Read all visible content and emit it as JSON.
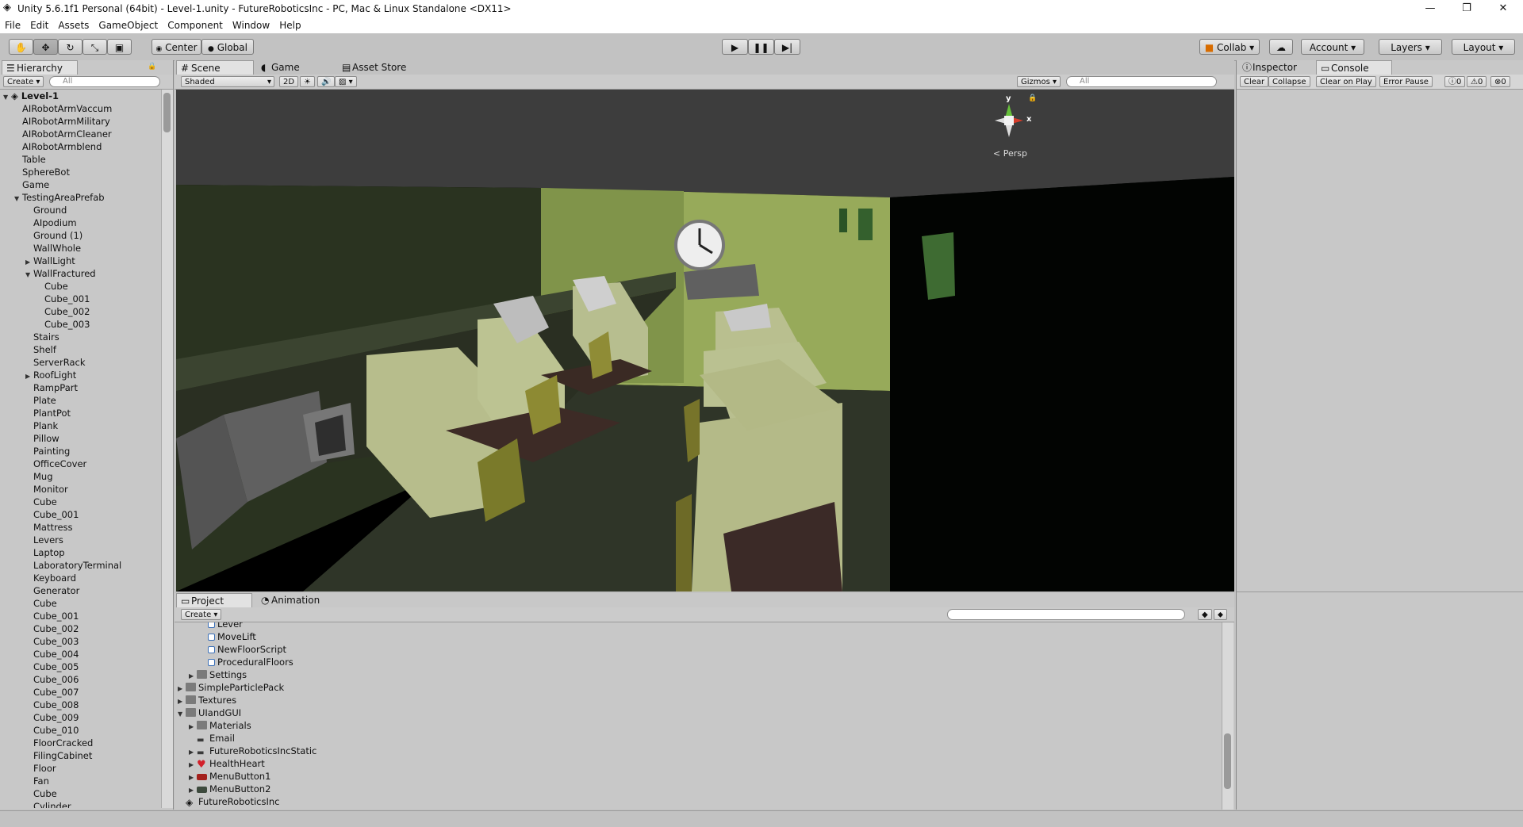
{
  "window": {
    "title": "Unity 5.6.1f1 Personal (64bit) - Level-1.unity - FutureRoboticsInc - PC, Mac & Linux Standalone <DX11>",
    "minimize": "—",
    "maximize": "❐",
    "close": "✕"
  },
  "menu": [
    "File",
    "Edit",
    "Assets",
    "GameObject",
    "Component",
    "Window",
    "Help"
  ],
  "toolbar": {
    "pivot": "Center",
    "space": "Global",
    "collab": "Collab",
    "account": "Account",
    "layers": "Layers",
    "layout": "Layout"
  },
  "hierarchy": {
    "tab": "Hierarchy",
    "create": "Create",
    "search_placeholder": "All",
    "scene": "Level-1",
    "items": [
      {
        "label": "AIRobotArmVaccum",
        "indent": 1
      },
      {
        "label": "AIRobotArmMilitary",
        "indent": 1
      },
      {
        "label": "AIRobotArmCleaner",
        "indent": 1
      },
      {
        "label": "AIRobotArmblend",
        "indent": 1
      },
      {
        "label": "Table",
        "indent": 1
      },
      {
        "label": "SphereBot",
        "indent": 1
      },
      {
        "label": "Game",
        "indent": 1
      },
      {
        "label": "TestingAreaPrefab",
        "indent": 1,
        "expanded": true
      },
      {
        "label": "Ground",
        "indent": 2
      },
      {
        "label": "AIpodium",
        "indent": 2
      },
      {
        "label": "Ground (1)",
        "indent": 2
      },
      {
        "label": "WallWhole",
        "indent": 2
      },
      {
        "label": "WallLight",
        "indent": 2,
        "collapsed": true
      },
      {
        "label": "WallFractured",
        "indent": 2,
        "expanded": true
      },
      {
        "label": "Cube",
        "indent": 3
      },
      {
        "label": "Cube_001",
        "indent": 3
      },
      {
        "label": "Cube_002",
        "indent": 3
      },
      {
        "label": "Cube_003",
        "indent": 3
      },
      {
        "label": "Stairs",
        "indent": 2
      },
      {
        "label": "Shelf",
        "indent": 2
      },
      {
        "label": "ServerRack",
        "indent": 2
      },
      {
        "label": "RoofLight",
        "indent": 2,
        "collapsed": true
      },
      {
        "label": "RampPart",
        "indent": 2
      },
      {
        "label": "Plate",
        "indent": 2
      },
      {
        "label": "PlantPot",
        "indent": 2
      },
      {
        "label": "Plank",
        "indent": 2
      },
      {
        "label": "Pillow",
        "indent": 2
      },
      {
        "label": "Painting",
        "indent": 2
      },
      {
        "label": "OfficeCover",
        "indent": 2
      },
      {
        "label": "Mug",
        "indent": 2
      },
      {
        "label": "Monitor",
        "indent": 2
      },
      {
        "label": "Cube",
        "indent": 2
      },
      {
        "label": "Cube_001",
        "indent": 2
      },
      {
        "label": "Mattress",
        "indent": 2
      },
      {
        "label": "Levers",
        "indent": 2
      },
      {
        "label": "Laptop",
        "indent": 2
      },
      {
        "label": "LaboratoryTerminal",
        "indent": 2
      },
      {
        "label": "Keyboard",
        "indent": 2
      },
      {
        "label": "Generator",
        "indent": 2
      },
      {
        "label": "Cube",
        "indent": 2
      },
      {
        "label": "Cube_001",
        "indent": 2
      },
      {
        "label": "Cube_002",
        "indent": 2
      },
      {
        "label": "Cube_003",
        "indent": 2
      },
      {
        "label": "Cube_004",
        "indent": 2
      },
      {
        "label": "Cube_005",
        "indent": 2
      },
      {
        "label": "Cube_006",
        "indent": 2
      },
      {
        "label": "Cube_007",
        "indent": 2
      },
      {
        "label": "Cube_008",
        "indent": 2
      },
      {
        "label": "Cube_009",
        "indent": 2
      },
      {
        "label": "Cube_010",
        "indent": 2
      },
      {
        "label": "FloorCracked",
        "indent": 2
      },
      {
        "label": "FilingCabinet",
        "indent": 2
      },
      {
        "label": "Floor",
        "indent": 2
      },
      {
        "label": "Fan",
        "indent": 2
      },
      {
        "label": "Cube",
        "indent": 2
      },
      {
        "label": "Cylinder",
        "indent": 2
      }
    ]
  },
  "scene_tabs": {
    "scene": "Scene",
    "game": "Game",
    "asset_store": "Asset Store"
  },
  "scene_bar": {
    "shading": "Shaded",
    "mode2d": "2D",
    "gizmos": "Gizmos",
    "search_placeholder": "All"
  },
  "scene_view": {
    "projection": "Persp",
    "gizmo_y": "y",
    "gizmo_x": "x"
  },
  "inspector": {
    "tab_inspector": "Inspector",
    "tab_console": "Console",
    "clear": "Clear",
    "collapse": "Collapse",
    "clear_on_play": "Clear on Play",
    "error_pause": "Error Pause",
    "count_info": "0",
    "count_warn": "0",
    "count_error": "0"
  },
  "project": {
    "tab_project": "Project",
    "tab_animation": "Animation",
    "create": "Create",
    "items": [
      {
        "label": "Lever",
        "indent": 3,
        "icon": "script"
      },
      {
        "label": "MoveLift",
        "indent": 3,
        "icon": "script"
      },
      {
        "label": "NewFloorScript",
        "indent": 3,
        "icon": "script"
      },
      {
        "label": "ProceduralFloors",
        "indent": 3,
        "icon": "script"
      },
      {
        "label": "Settings",
        "indent": 2,
        "icon": "folder",
        "arrow": "right"
      },
      {
        "label": "SimpleParticlePack",
        "indent": 1,
        "icon": "folder",
        "arrow": "right"
      },
      {
        "label": "Textures",
        "indent": 1,
        "icon": "folder",
        "arrow": "right"
      },
      {
        "label": "UIandGUI",
        "indent": 1,
        "icon": "folder",
        "arrow": "down"
      },
      {
        "label": "Materials",
        "indent": 2,
        "icon": "folder",
        "arrow": "right"
      },
      {
        "label": "Email",
        "indent": 2,
        "icon": "image"
      },
      {
        "label": "FutureRoboticsIncStatic",
        "indent": 2,
        "icon": "image",
        "arrow": "right"
      },
      {
        "label": "HealthHeart",
        "indent": 2,
        "icon": "heart",
        "arrow": "right"
      },
      {
        "label": "MenuButton1",
        "indent": 2,
        "icon": "redbtn",
        "arrow": "right"
      },
      {
        "label": "MenuButton2",
        "indent": 2,
        "icon": "darkbtn",
        "arrow": "right"
      },
      {
        "label": "FutureRoboticsInc",
        "indent": 1,
        "icon": "unity"
      }
    ]
  }
}
